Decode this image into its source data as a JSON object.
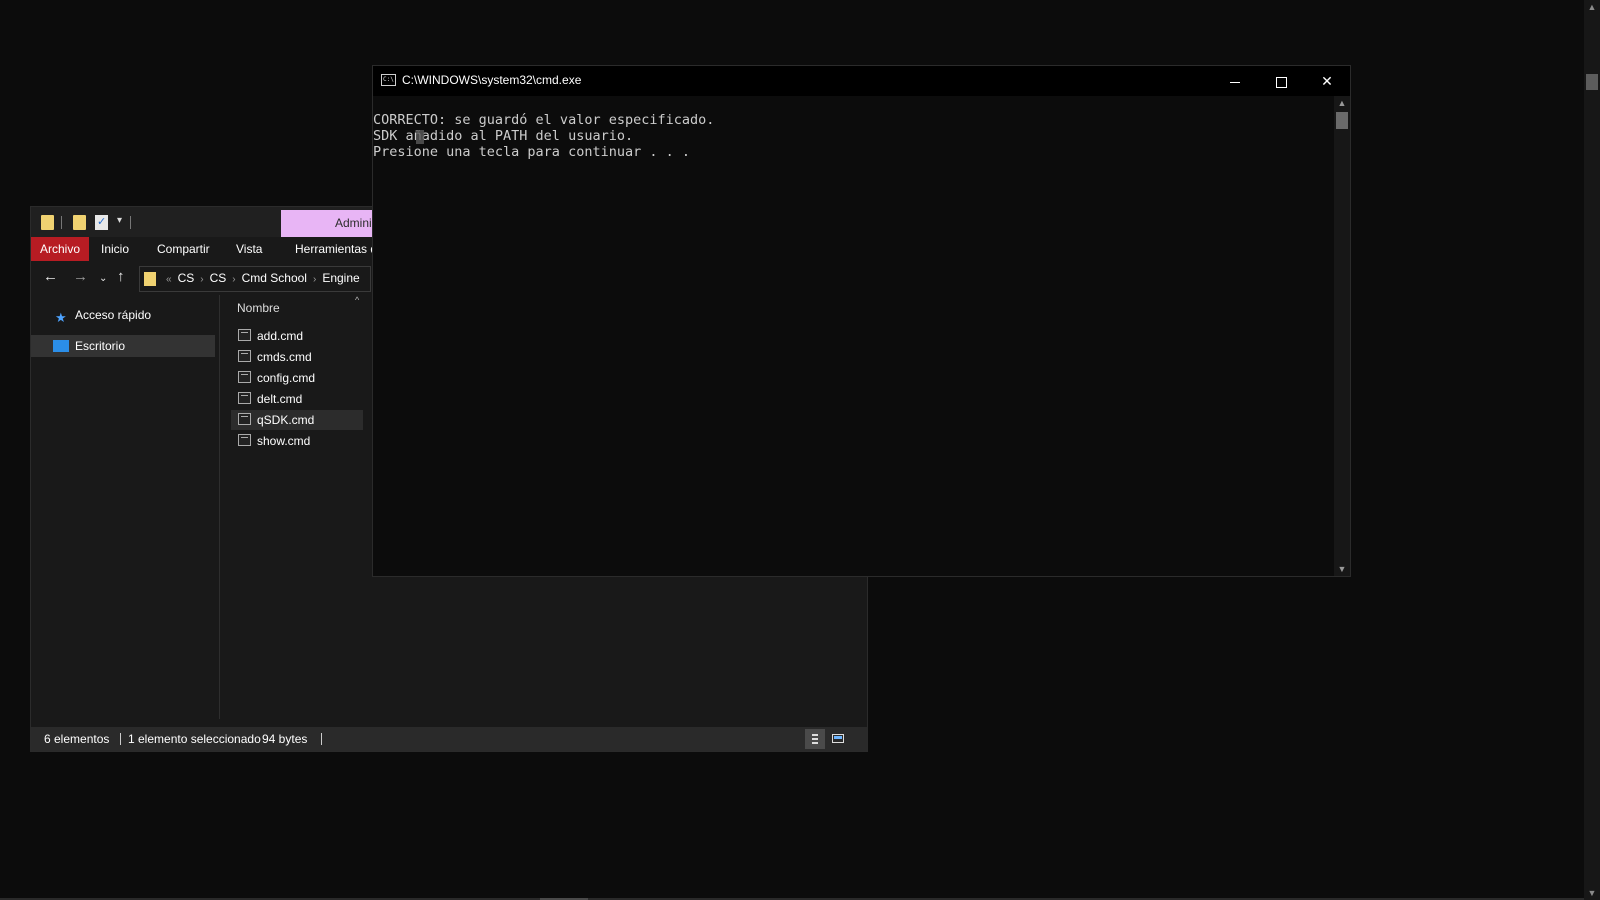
{
  "explorer": {
    "context_tab": "Admini",
    "ribbon_tabs": [
      "Archivo",
      "Inicio",
      "Compartir",
      "Vista",
      "Herramientas d"
    ],
    "address": {
      "overflow": "«",
      "crumbs": [
        "CS",
        "CS",
        "Cmd School",
        "Engine"
      ]
    },
    "nav": {
      "quick_access": "Acceso rápido",
      "desktop": "Escritorio"
    },
    "column_name": "Nombre",
    "files": [
      "add.cmd",
      "cmds.cmd",
      "config.cmd",
      "delt.cmd",
      "qSDK.cmd",
      "show.cmd"
    ],
    "selected_file": "qSDK.cmd",
    "status": {
      "count": "6 elementos",
      "selection": "1 elemento seleccionado",
      "size": "94 bytes"
    }
  },
  "cmd": {
    "title": "C:\\WINDOWS\\system32\\cmd.exe",
    "lines": [
      "CORRECTO: se guardó el valor especificado.",
      "SDK añadido al PATH del usuario.",
      "Presione una tecla para continuar . . ."
    ]
  },
  "icons": {
    "close": "close-icon",
    "minimize": "minimize-icon",
    "maximize": "maximize-icon"
  },
  "colors": {
    "file_tab": "#b71c23",
    "context_tab": "#e8b5f5",
    "folder": "#f0d271",
    "desktop_icon": "#2b8ee8"
  }
}
